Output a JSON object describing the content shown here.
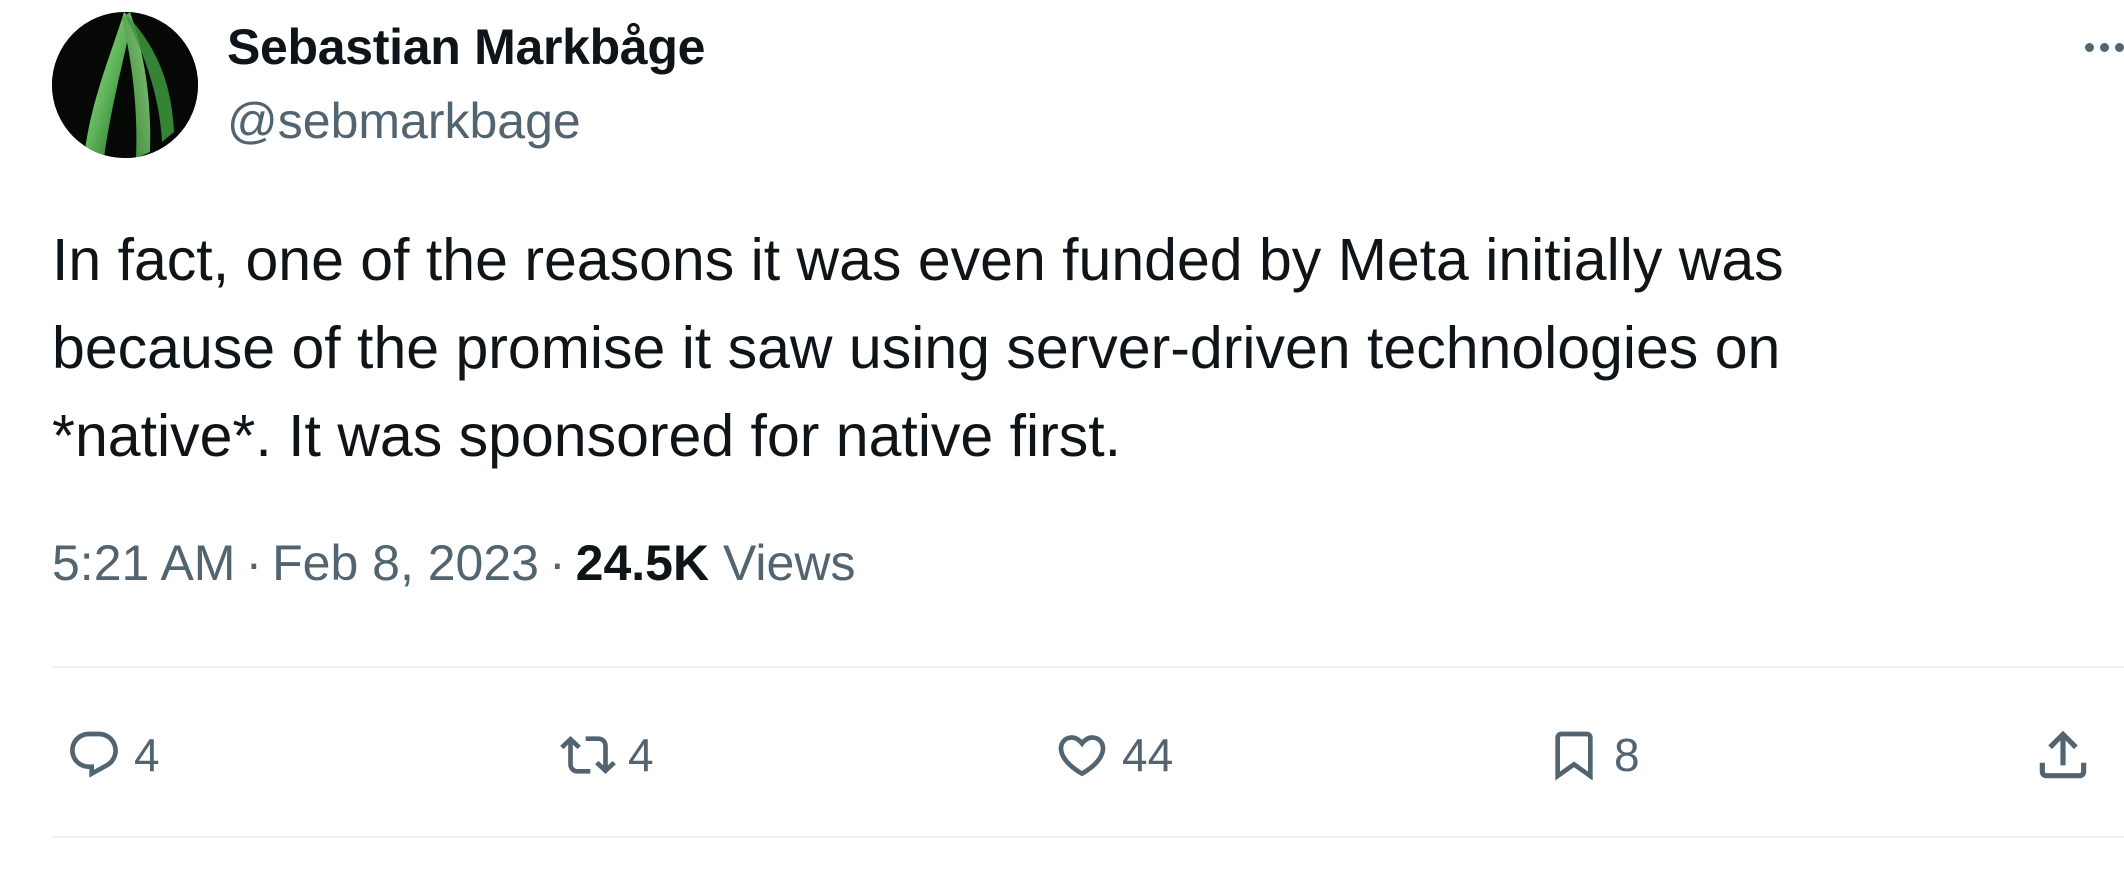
{
  "author": {
    "display_name": "Sebastian Markbåge",
    "handle": "@sebmarkbage"
  },
  "tweet": {
    "text_lines": [
      "In fact, one of the reasons it was even funded by Meta initially was",
      "because of the promise it saw using server-driven technologies on",
      "*native*. It was sponsored for native first."
    ],
    "time": "5:21 AM",
    "date": "Feb 8, 2023",
    "views_count": "24.5K",
    "views_label": "Views",
    "separator": "·"
  },
  "actions": {
    "reply": {
      "icon": "reply-icon",
      "count": "4"
    },
    "retweet": {
      "icon": "retweet-icon",
      "count": "4"
    },
    "like": {
      "icon": "heart-icon",
      "count": "44"
    },
    "bookmark": {
      "icon": "bookmark-icon",
      "count": "8"
    },
    "share": {
      "icon": "share-icon"
    }
  },
  "colors": {
    "text_primary": "#0f1419",
    "text_secondary": "#536471",
    "divider": "#eff3f4",
    "avatar_leaf": "#5fb65a"
  }
}
